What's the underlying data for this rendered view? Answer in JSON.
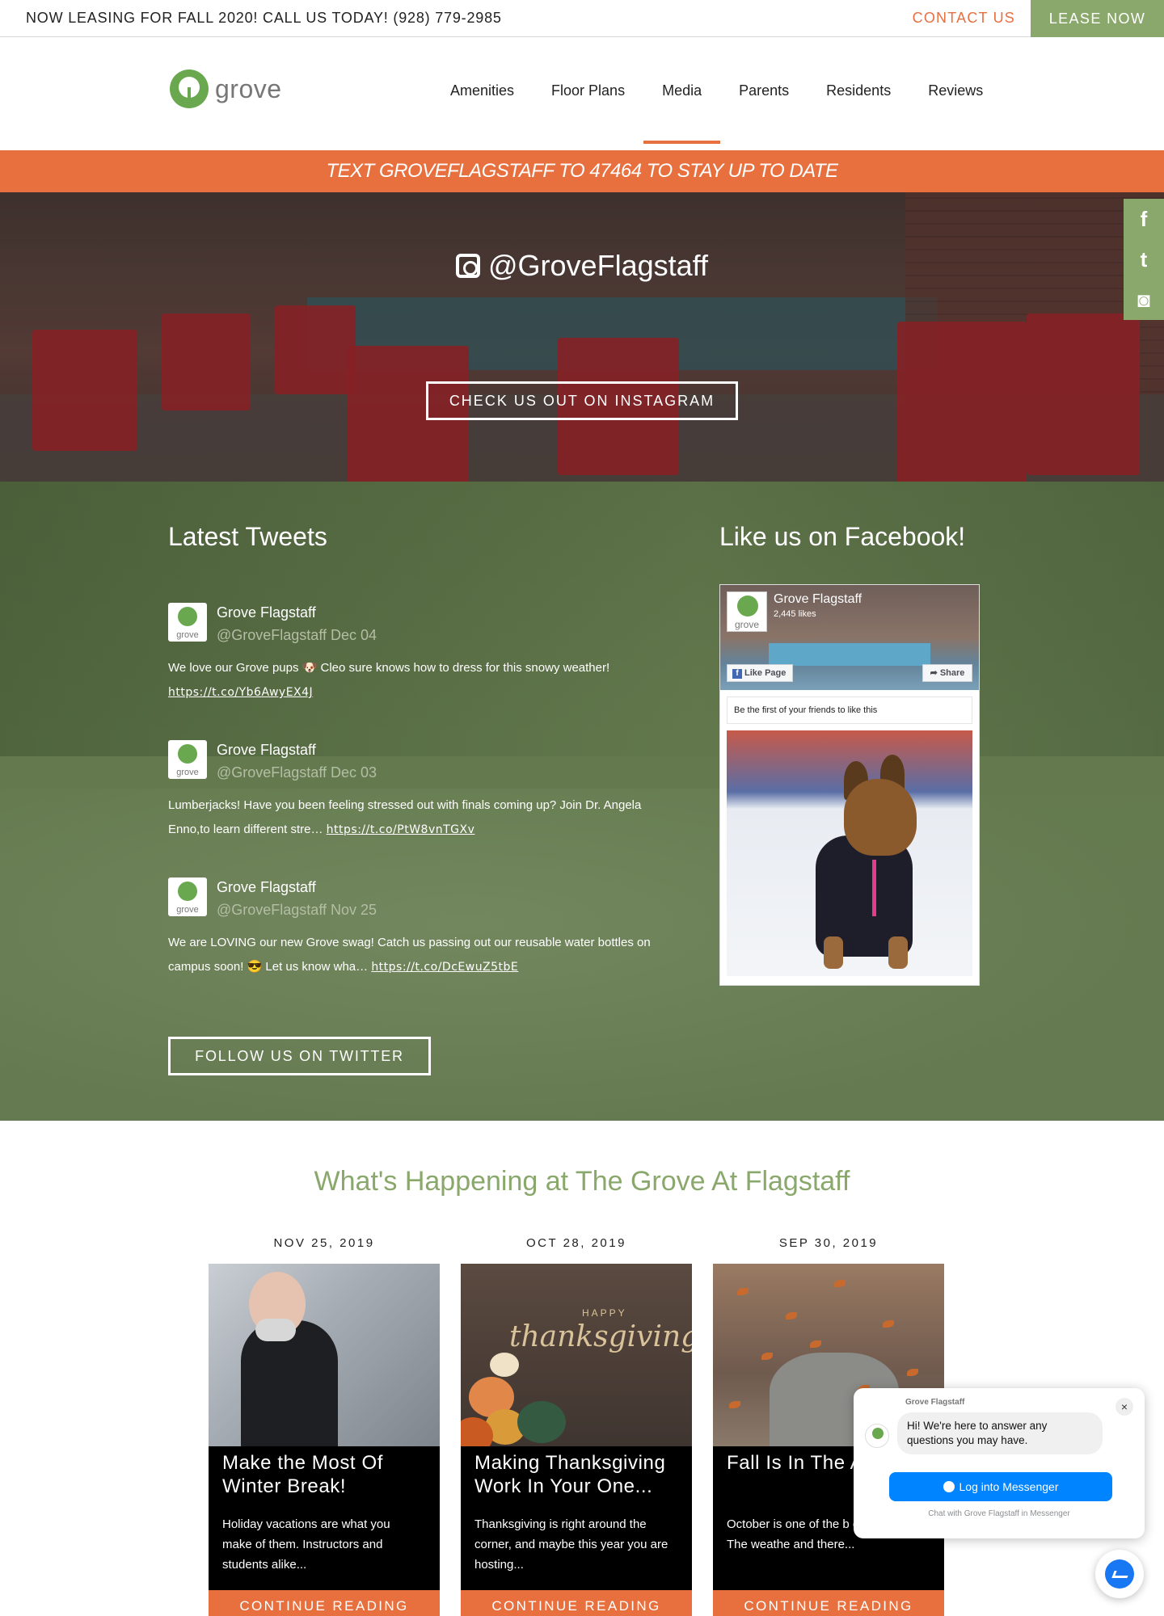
{
  "topbar": {
    "announcement": "NOW LEASING FOR FALL 2020! CALL US TODAY! (928) 779-2985",
    "contact_label": "CONTACT US",
    "lease_label": "LEASE NOW"
  },
  "header": {
    "logo_text": "grove",
    "nav": [
      "Amenities",
      "Floor Plans",
      "Media",
      "Parents",
      "Residents",
      "Reviews"
    ],
    "active_nav": "Media"
  },
  "text_banner": "TEXT GROVEFLAGSTAFF TO 47464 TO STAY UP TO DATE",
  "instagram": {
    "handle": "@GroveFlagstaff",
    "button_label": "CHECK US OUT ON INSTAGRAM"
  },
  "social_icons": [
    "facebook-icon",
    "twitter-icon",
    "instagram-icon"
  ],
  "tweets": {
    "title": "Latest Tweets",
    "items": [
      {
        "name": "Grove Flagstaff",
        "meta": "@GroveFlagstaff Dec 04",
        "text": "We love our Grove pups 🐶 Cleo sure knows how to dress for this snowy weather!",
        "link": "https://t.co/Yb6AwyEX4J"
      },
      {
        "name": "Grove Flagstaff",
        "meta": "@GroveFlagstaff Dec 03",
        "text": "Lumberjacks! Have you been feeling stressed out with finals coming up? Join Dr. Angela Enno,to learn different stre…",
        "link": "https://t.co/PtW8vnTGXv"
      },
      {
        "name": "Grove Flagstaff",
        "meta": "@GroveFlagstaff Nov 25",
        "text": "We are LOVING our new Grove swag! Catch us passing out our reusable water bottles on campus soon! 😎 Let us know wha…",
        "link": "https://t.co/DcEwuZ5tbE"
      }
    ],
    "follow_label": "FOLLOW US ON TWITTER"
  },
  "facebook": {
    "title": "Like us on Facebook!",
    "page_name": "Grove Flagstaff",
    "likes": "2,445 likes",
    "like_label": "Like Page",
    "share_label": "Share",
    "friends_text": "Be the first of your friends to like this"
  },
  "happening": {
    "title": "What's Happening at The Grove At Flagstaff",
    "posts": [
      {
        "date": "NOV 25, 2019",
        "title": "Make the Most Of Winter Break!",
        "excerpt": "Holiday vacations are what you make of them. Instructors and students alike...",
        "cta": "CONTINUE READING"
      },
      {
        "date": "OCT 28, 2019",
        "title": "Making Thanksgiving Work In Your One...",
        "excerpt": "Thanksgiving is right around the corner, and maybe this year you are hosting...",
        "cta": "CONTINUE READING"
      },
      {
        "date": "SEP 30, 2019",
        "title": "Fall Is In The A",
        "excerpt": "October is one of the b of the year. The weathe and there...",
        "cta": "CONTINUE READING"
      }
    ],
    "thanksgiving_image_happy": "HAPPY",
    "thanksgiving_image_word": "thanksgiving"
  },
  "messenger": {
    "page_name": "Grove Flagstaff",
    "greeting": "Hi! We're here to answer any questions you may have.",
    "login_label": "Log into Messenger",
    "chat_with": "Chat with Grove Flagstaff in Messenger",
    "close_symbol": "×"
  },
  "colors": {
    "accent_orange": "#e8703f",
    "brand_green": "#8aa86c",
    "messenger_blue": "#0084ff"
  }
}
